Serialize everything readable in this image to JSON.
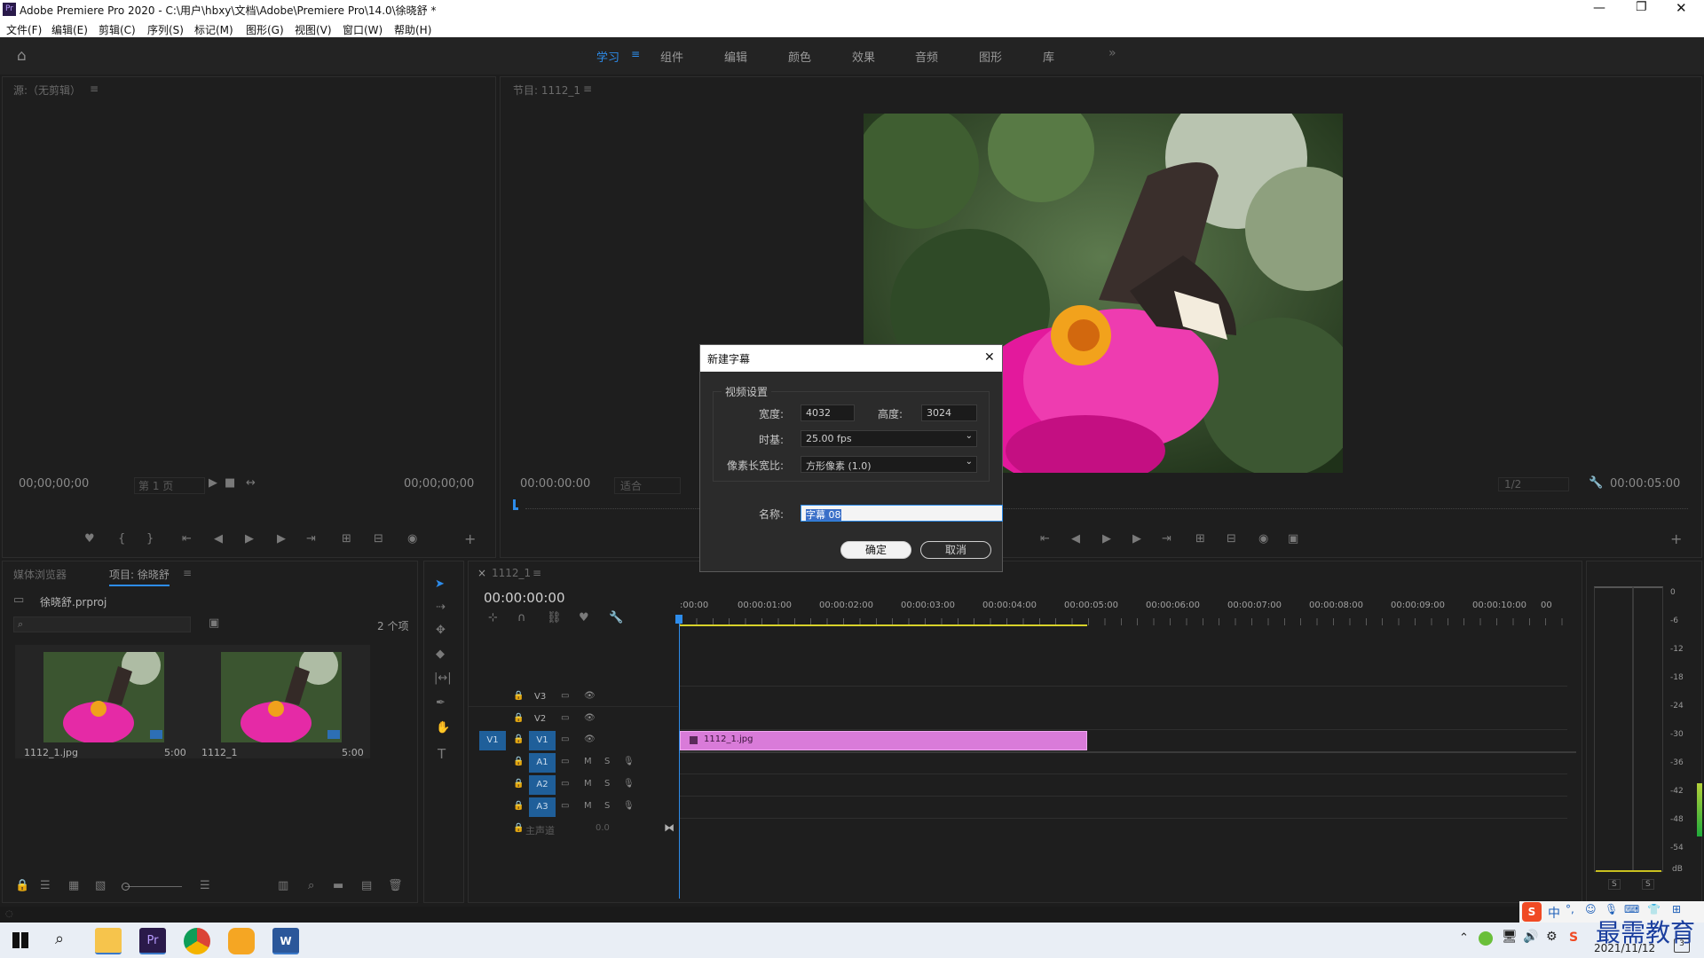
{
  "window": {
    "title": "Adobe Premiere Pro 2020 - C:\\用户\\hbxy\\文档\\Adobe\\Premiere Pro\\14.0\\徐晓舒 *",
    "app_icon": "Pr"
  },
  "menu": [
    "文件(F)",
    "编辑(E)",
    "剪辑(C)",
    "序列(S)",
    "标记(M)",
    "图形(G)",
    "视图(V)",
    "窗口(W)",
    "帮助(H)"
  ],
  "workspaces": {
    "items": [
      "学习",
      "组件",
      "编辑",
      "颜色",
      "效果",
      "音频",
      "图形",
      "库"
    ],
    "active": "学习",
    "active_color": "#2d8ceb"
  },
  "source_monitor": {
    "tab": "源:（无剪辑）",
    "timecode_left": "00;00;00;00",
    "page": "第 1 页",
    "timecode_right": "00;00;00;00"
  },
  "program_monitor": {
    "tab": "节目: 1112_1",
    "timecode_left": "00:00:00:00",
    "fit": "适合",
    "resolution": "1/2",
    "timecode_right": "00:00:05:00"
  },
  "project_panel": {
    "tab_media": "媒体浏览器",
    "tab_project": "项目: 徐晓舒",
    "file": "徐晓舒.prproj",
    "count": "2 个项",
    "items": [
      {
        "name": "1112_1.jpg",
        "duration": "5:00"
      },
      {
        "name": "1112_1",
        "duration": "5:00"
      }
    ]
  },
  "timeline": {
    "tab": "1112_1",
    "timecode": "00:00:00:00",
    "ruler": [
      ":00:00",
      "00:00:01:00",
      "00:00:02:00",
      "00:00:03:00",
      "00:00:04:00",
      "00:00:05:00",
      "00:00:06:00",
      "00:00:07:00",
      "00:00:08:00",
      "00:00:09:00",
      "00:00:10:00",
      "00"
    ],
    "video_tracks": [
      "V3",
      "V2",
      "V1"
    ],
    "source_v": "V1",
    "audio_tracks": [
      "A1",
      "A2",
      "A3"
    ],
    "master": {
      "label": "主声道",
      "value": "0.0"
    },
    "clip": {
      "name": "1112_1.jpg",
      "color": "#d97bd9"
    }
  },
  "audio_meter": {
    "scale": [
      "0",
      "-6",
      "-12",
      "-18",
      "-24",
      "-30",
      "-36",
      "-42",
      "-48",
      "-54",
      "dB"
    ],
    "solo": [
      "S",
      "S"
    ]
  },
  "dialog": {
    "title": "新建字幕",
    "group": "视频设置",
    "width_label": "宽度:",
    "width": "4032",
    "height_label": "高度:",
    "height": "3024",
    "timebase_label": "时基:",
    "timebase": "25.00 fps",
    "par_label": "像素长宽比:",
    "par": "方形像素 (1.0)",
    "name_label": "名称:",
    "name": "字幕 08",
    "ok": "确定",
    "cancel": "取消"
  },
  "watermark": "最需教育",
  "ime": {
    "label": "中"
  },
  "taskbar": {
    "date": "2021/11/12",
    "notification_count": "3"
  }
}
